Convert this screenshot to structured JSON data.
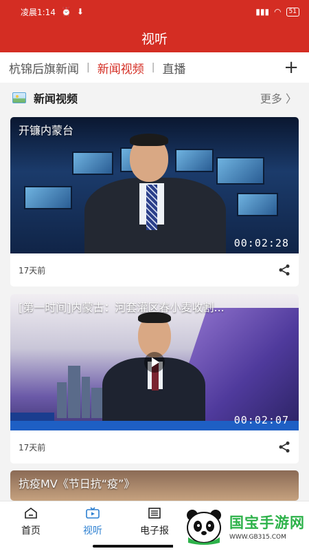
{
  "status_bar": {
    "time": "凌晨1:14",
    "battery": "51"
  },
  "header": {
    "title": "视听"
  },
  "tabs": [
    {
      "label": "杭锦后旗新闻",
      "active": false
    },
    {
      "label": "新闻视频",
      "active": true
    },
    {
      "label": "直播",
      "active": false
    }
  ],
  "section": {
    "title": "新闻视频",
    "more": "更多 〉"
  },
  "videos": [
    {
      "title": "开镰内蒙台",
      "duration": "00:02:28",
      "age": "17天前"
    },
    {
      "title": "[第一时间]内蒙古：河套灌区春小麦收割...",
      "duration": "00:02:07",
      "age": "17天前"
    },
    {
      "title": "抗疫MV《节日抗“疫”》"
    }
  ],
  "bottom_nav": [
    {
      "label": "首页",
      "icon": "home-icon",
      "active": false
    },
    {
      "label": "视听",
      "icon": "tv-icon",
      "active": true
    },
    {
      "label": "电子报",
      "icon": "newspaper-icon",
      "active": false
    }
  ],
  "watermark": {
    "brand": "国宝手游网",
    "url": "WWW.GB315.COM"
  },
  "colors": {
    "brand_red": "#d42d23",
    "nav_active": "#2b7fd1",
    "watermark_green": "#2db24a"
  }
}
